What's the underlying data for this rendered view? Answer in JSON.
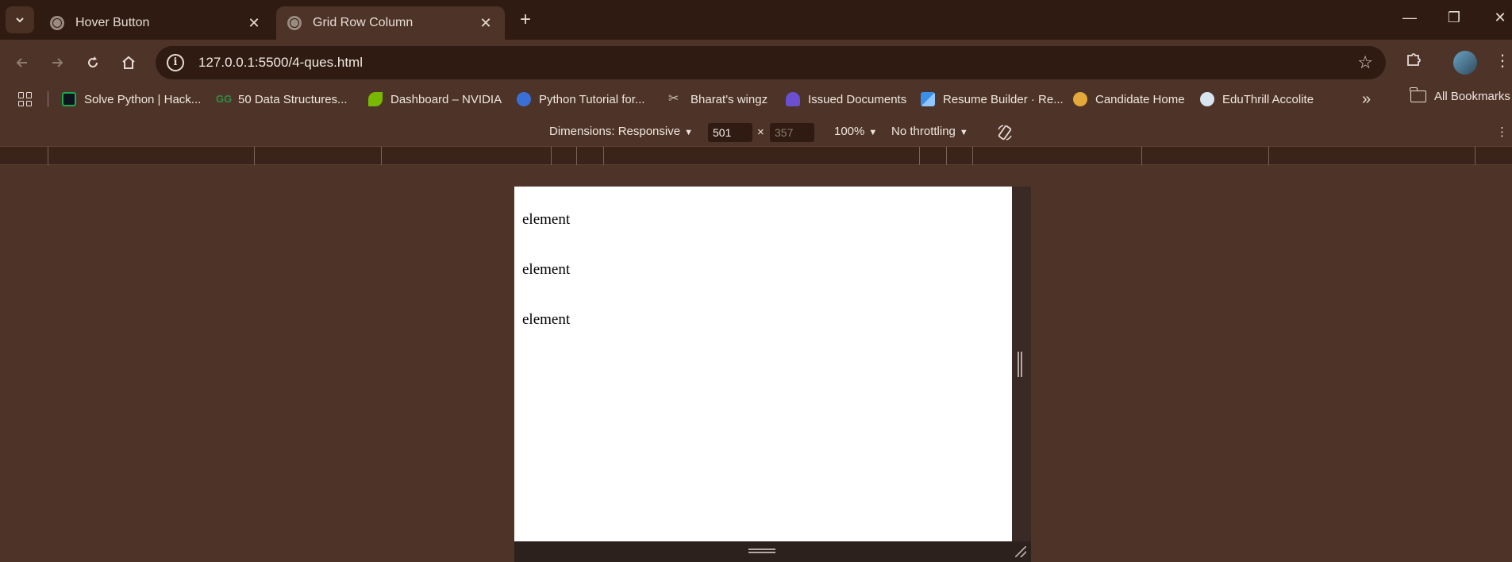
{
  "tabs": [
    {
      "title": "Hover Button",
      "active": false
    },
    {
      "title": "Grid Row Column",
      "active": true
    }
  ],
  "tabbar": {
    "new_tab": "+",
    "close": "✕",
    "minimize": "—",
    "restore": "❐",
    "window_close": "✕"
  },
  "address_bar": {
    "url": "127.0.0.1:5500/4-ques.html"
  },
  "bookmarks": [
    {
      "label": "Solve Python | Hack...",
      "icon": "hackerrank-icon",
      "color": "#1ba94c"
    },
    {
      "label": "50 Data Structures...",
      "icon": "geeksforgeeks-icon",
      "color": "#2f8d46"
    },
    {
      "label": "Dashboard – NVIDIA",
      "icon": "nvidia-icon",
      "color": "#76b900"
    },
    {
      "label": "Python Tutorial for...",
      "icon": "globe-blue-icon",
      "color": "#3b6fd8"
    },
    {
      "label": "Bharat's wingz",
      "icon": "wingz-icon",
      "color": "#c9c3b5"
    },
    {
      "label": "Issued Documents",
      "icon": "cloud-document-icon",
      "color": "#6a4fd0"
    },
    {
      "label": "Resume Builder · Re...",
      "icon": "resume-builder-icon",
      "color": "#3a8fe8"
    },
    {
      "label": "Candidate Home",
      "icon": "candidate-icon",
      "color": "#e3a93a"
    },
    {
      "label": "EduThrill Accolite",
      "icon": "eduthrill-icon",
      "color": "#d8e4ee"
    }
  ],
  "bookmarks_more": "»",
  "all_bookmarks": "All Bookmarks",
  "device_toolbar": {
    "dimensions": "Dimensions: Responsive",
    "width": "501",
    "times": "×",
    "height_placeholder": "357",
    "zoom": "100%",
    "throttling": "No throttling",
    "caret": "▼"
  },
  "viewport": {
    "elements": [
      "element",
      "element",
      "element"
    ]
  },
  "colors": {
    "tabstrip": "#2f1b11",
    "chrome": "#4e3428",
    "omnibox": "#2f1b11",
    "viewport_bg": "#ffffff"
  }
}
